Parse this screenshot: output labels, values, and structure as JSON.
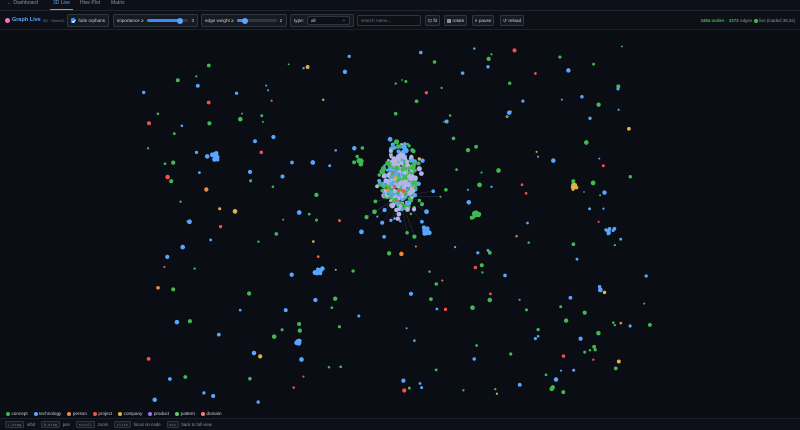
{
  "tabs": [
    "← Dashboard",
    "3D Live",
    "Hive Plot",
    "Matrix"
  ],
  "active_tab": 1,
  "brand": {
    "title": "Graph Live",
    "subtitle": "3D · WebGL"
  },
  "controls": {
    "hide_orphans_label": "hide orphans",
    "hide_orphans_checked": true,
    "importance_label": "importance ≥",
    "importance_value": "3",
    "importance_fill_fraction": 0.75,
    "edge_weight_label": "edge weight ≥",
    "edge_weight_value": "2",
    "edge_weight_fill_fraction": 0.2,
    "type_label": "type:",
    "type_selected": "all",
    "search_placeholder": "search name...",
    "fit_label": "fit",
    "rotate_label": "rotate",
    "pause_label": "pause",
    "reload_label": "reload"
  },
  "status": {
    "nodes": "3484 nodes",
    "separator": "·",
    "edges": "3373",
    "edges_label": "edges",
    "live_label": "live (loaded 38.3s)"
  },
  "legend": [
    {
      "label": "concept",
      "color": "#3fb950"
    },
    {
      "label": "technology",
      "color": "#58a6ff"
    },
    {
      "label": "person",
      "color": "#f0883e"
    },
    {
      "label": "project",
      "color": "#f85149"
    },
    {
      "label": "company",
      "color": "#e3b341"
    },
    {
      "label": "product",
      "color": "#a371f7"
    },
    {
      "label": "pattern",
      "color": "#56d364"
    },
    {
      "label": "domain",
      "color": "#ff7b72"
    }
  ],
  "hints": [
    {
      "key": "L-drag",
      "text": "orbit"
    },
    {
      "key": "R-drag",
      "text": "pan"
    },
    {
      "key": "scroll",
      "text": "zoom"
    },
    {
      "key": "click",
      "text": "focus on node"
    },
    {
      "key": "esc",
      "text": "back to full view"
    }
  ],
  "colors": {
    "background": "#0b0d14",
    "accent": "#58a6ff",
    "node_green": "#3fb950",
    "node_blue": "#58a6ff",
    "node_red": "#f85149",
    "node_yellow": "#e3b341",
    "node_orange": "#f0883e",
    "node_lavender": "#b4b4e6"
  }
}
